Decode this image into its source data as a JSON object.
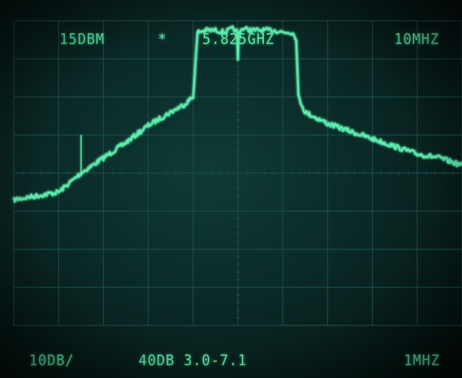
{
  "readouts": {
    "reference_level": "15DBM",
    "marker_symbol": "*",
    "center_frequency": "5.825GHZ",
    "span_per_division": "10MHZ",
    "vertical_scale": "10DB/",
    "attenuation_info": "40DB 3.0-7.1",
    "resolution_bandwidth": "1MHZ"
  },
  "colors": {
    "trace": "#5ff0b0",
    "grid": "#1d4e48",
    "text": "#5fe3a6"
  },
  "chart_data": {
    "type": "line",
    "title": "",
    "xlabel": "",
    "ylabel": "",
    "xlim": [
      -5,
      5
    ],
    "ylim": [
      -8,
      0
    ],
    "grid": true,
    "series": [
      {
        "x": [
          -5.0,
          -4.5,
          -4.0,
          -3.5,
          -3.0,
          -2.5,
          -2.0,
          -1.5,
          -1.2,
          -1.0,
          -0.9,
          -0.7,
          -0.5,
          -0.3,
          -0.1,
          -0.02,
          0.0,
          0.02,
          0.1,
          0.3,
          0.5,
          0.8,
          1.0,
          1.2,
          1.3,
          1.35,
          1.5,
          2.0,
          2.5,
          3.0,
          3.5,
          4.0,
          4.5,
          5.0
        ],
        "y": [
          -4.7,
          -4.6,
          -4.5,
          -4.0,
          -3.6,
          -3.2,
          -2.75,
          -2.4,
          -2.2,
          -2.0,
          -0.3,
          -0.25,
          -0.25,
          -0.3,
          -0.2,
          -0.3,
          -1.0,
          -0.3,
          -0.2,
          -0.25,
          -0.25,
          -0.25,
          -0.3,
          -0.3,
          -0.45,
          -2.0,
          -2.4,
          -2.7,
          -2.9,
          -3.1,
          -3.3,
          -3.5,
          -3.6,
          -3.8
        ]
      }
    ]
  }
}
